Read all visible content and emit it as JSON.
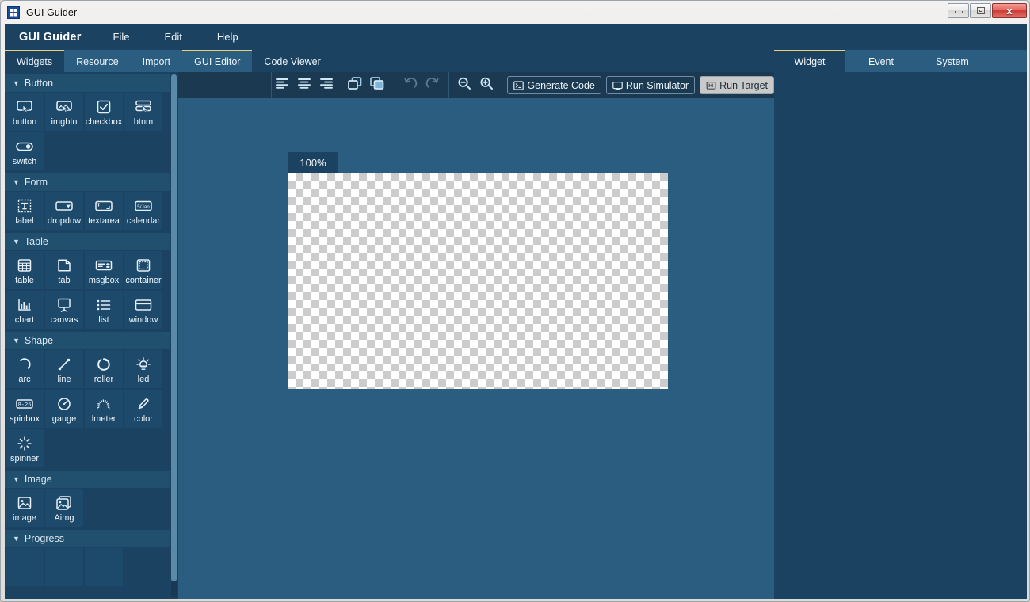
{
  "window": {
    "title": "GUI Guider",
    "app_icon": "app-logo-icon",
    "controls": {
      "minimize": "minimize-button",
      "maximize": "maximize-button",
      "close_glyph": "x"
    }
  },
  "menu": {
    "brand": "GUI Guider",
    "items": [
      {
        "label": "File"
      },
      {
        "label": "Edit"
      },
      {
        "label": "Help"
      }
    ]
  },
  "tab_strip": {
    "left": [
      {
        "label": "Widgets",
        "active": true
      },
      {
        "label": "Resource",
        "active": false
      },
      {
        "label": "Import",
        "active": false
      }
    ],
    "right": [
      {
        "label": "GUI Editor",
        "active": true
      },
      {
        "label": "Code Viewer",
        "active": false
      }
    ]
  },
  "palette": {
    "sections": [
      {
        "title": "Button",
        "items": [
          {
            "label": "button",
            "icon": "button-icon"
          },
          {
            "label": "imgbtn",
            "icon": "image-button-icon"
          },
          {
            "label": "checkbox",
            "icon": "checkbox-icon"
          },
          {
            "label": "btnm",
            "icon": "button-matrix-icon"
          },
          {
            "label": "switch",
            "icon": "switch-icon"
          }
        ]
      },
      {
        "title": "Form",
        "items": [
          {
            "label": "label",
            "icon": "label-icon"
          },
          {
            "label": "dropdow",
            "icon": "dropdown-icon"
          },
          {
            "label": "textarea",
            "icon": "textarea-icon"
          },
          {
            "label": "calendar",
            "icon": "calendar-icon"
          }
        ]
      },
      {
        "title": "Table",
        "items": [
          {
            "label": "table",
            "icon": "table-icon"
          },
          {
            "label": "tab",
            "icon": "tab-icon"
          },
          {
            "label": "msgbox",
            "icon": "messagebox-icon"
          },
          {
            "label": "container",
            "icon": "container-icon"
          },
          {
            "label": "chart",
            "icon": "chart-icon"
          },
          {
            "label": "canvas",
            "icon": "canvas-icon"
          },
          {
            "label": "list",
            "icon": "list-icon"
          },
          {
            "label": "window",
            "icon": "window-icon"
          }
        ]
      },
      {
        "title": "Shape",
        "items": [
          {
            "label": "arc",
            "icon": "arc-icon"
          },
          {
            "label": "line",
            "icon": "line-icon"
          },
          {
            "label": "roller",
            "icon": "roller-icon"
          },
          {
            "label": "led",
            "icon": "led-icon"
          },
          {
            "label": "spinbox",
            "icon": "spinbox-icon"
          },
          {
            "label": "gauge",
            "icon": "gauge-icon"
          },
          {
            "label": "lmeter",
            "icon": "linemeter-icon"
          },
          {
            "label": "color",
            "icon": "color-picker-icon"
          },
          {
            "label": "spinner",
            "icon": "spinner-icon"
          }
        ]
      },
      {
        "title": "Image",
        "items": [
          {
            "label": "image",
            "icon": "image-icon"
          },
          {
            "label": "Aimg",
            "icon": "animated-image-icon"
          }
        ]
      },
      {
        "title": "Progress",
        "items": []
      }
    ]
  },
  "toolbar": {
    "align_left": "align-left-icon",
    "align_center": "align-center-icon",
    "align_right": "align-right-icon",
    "bring_forward": "bring-forward-icon",
    "send_backward": "send-backward-icon",
    "undo": "undo-icon",
    "redo": "redo-icon",
    "zoom_out": "zoom-out-icon",
    "zoom_in": "zoom-in-icon",
    "generate_code": "Generate Code",
    "run_simulator": "Run Simulator",
    "run_target": "Run Target"
  },
  "canvas": {
    "zoom_level": "100%"
  },
  "inspector": {
    "tabs": [
      {
        "label": "Widget",
        "active": true
      },
      {
        "label": "Event",
        "active": false
      },
      {
        "label": "System",
        "active": false
      }
    ]
  },
  "colors": {
    "panel_dark": "#1b4261",
    "canvas_bg": "#2a5d80",
    "toolbar_bg": "#1b3a52",
    "accent_gold": "#e8d07a",
    "cell_bg": "#1d4a6b"
  }
}
